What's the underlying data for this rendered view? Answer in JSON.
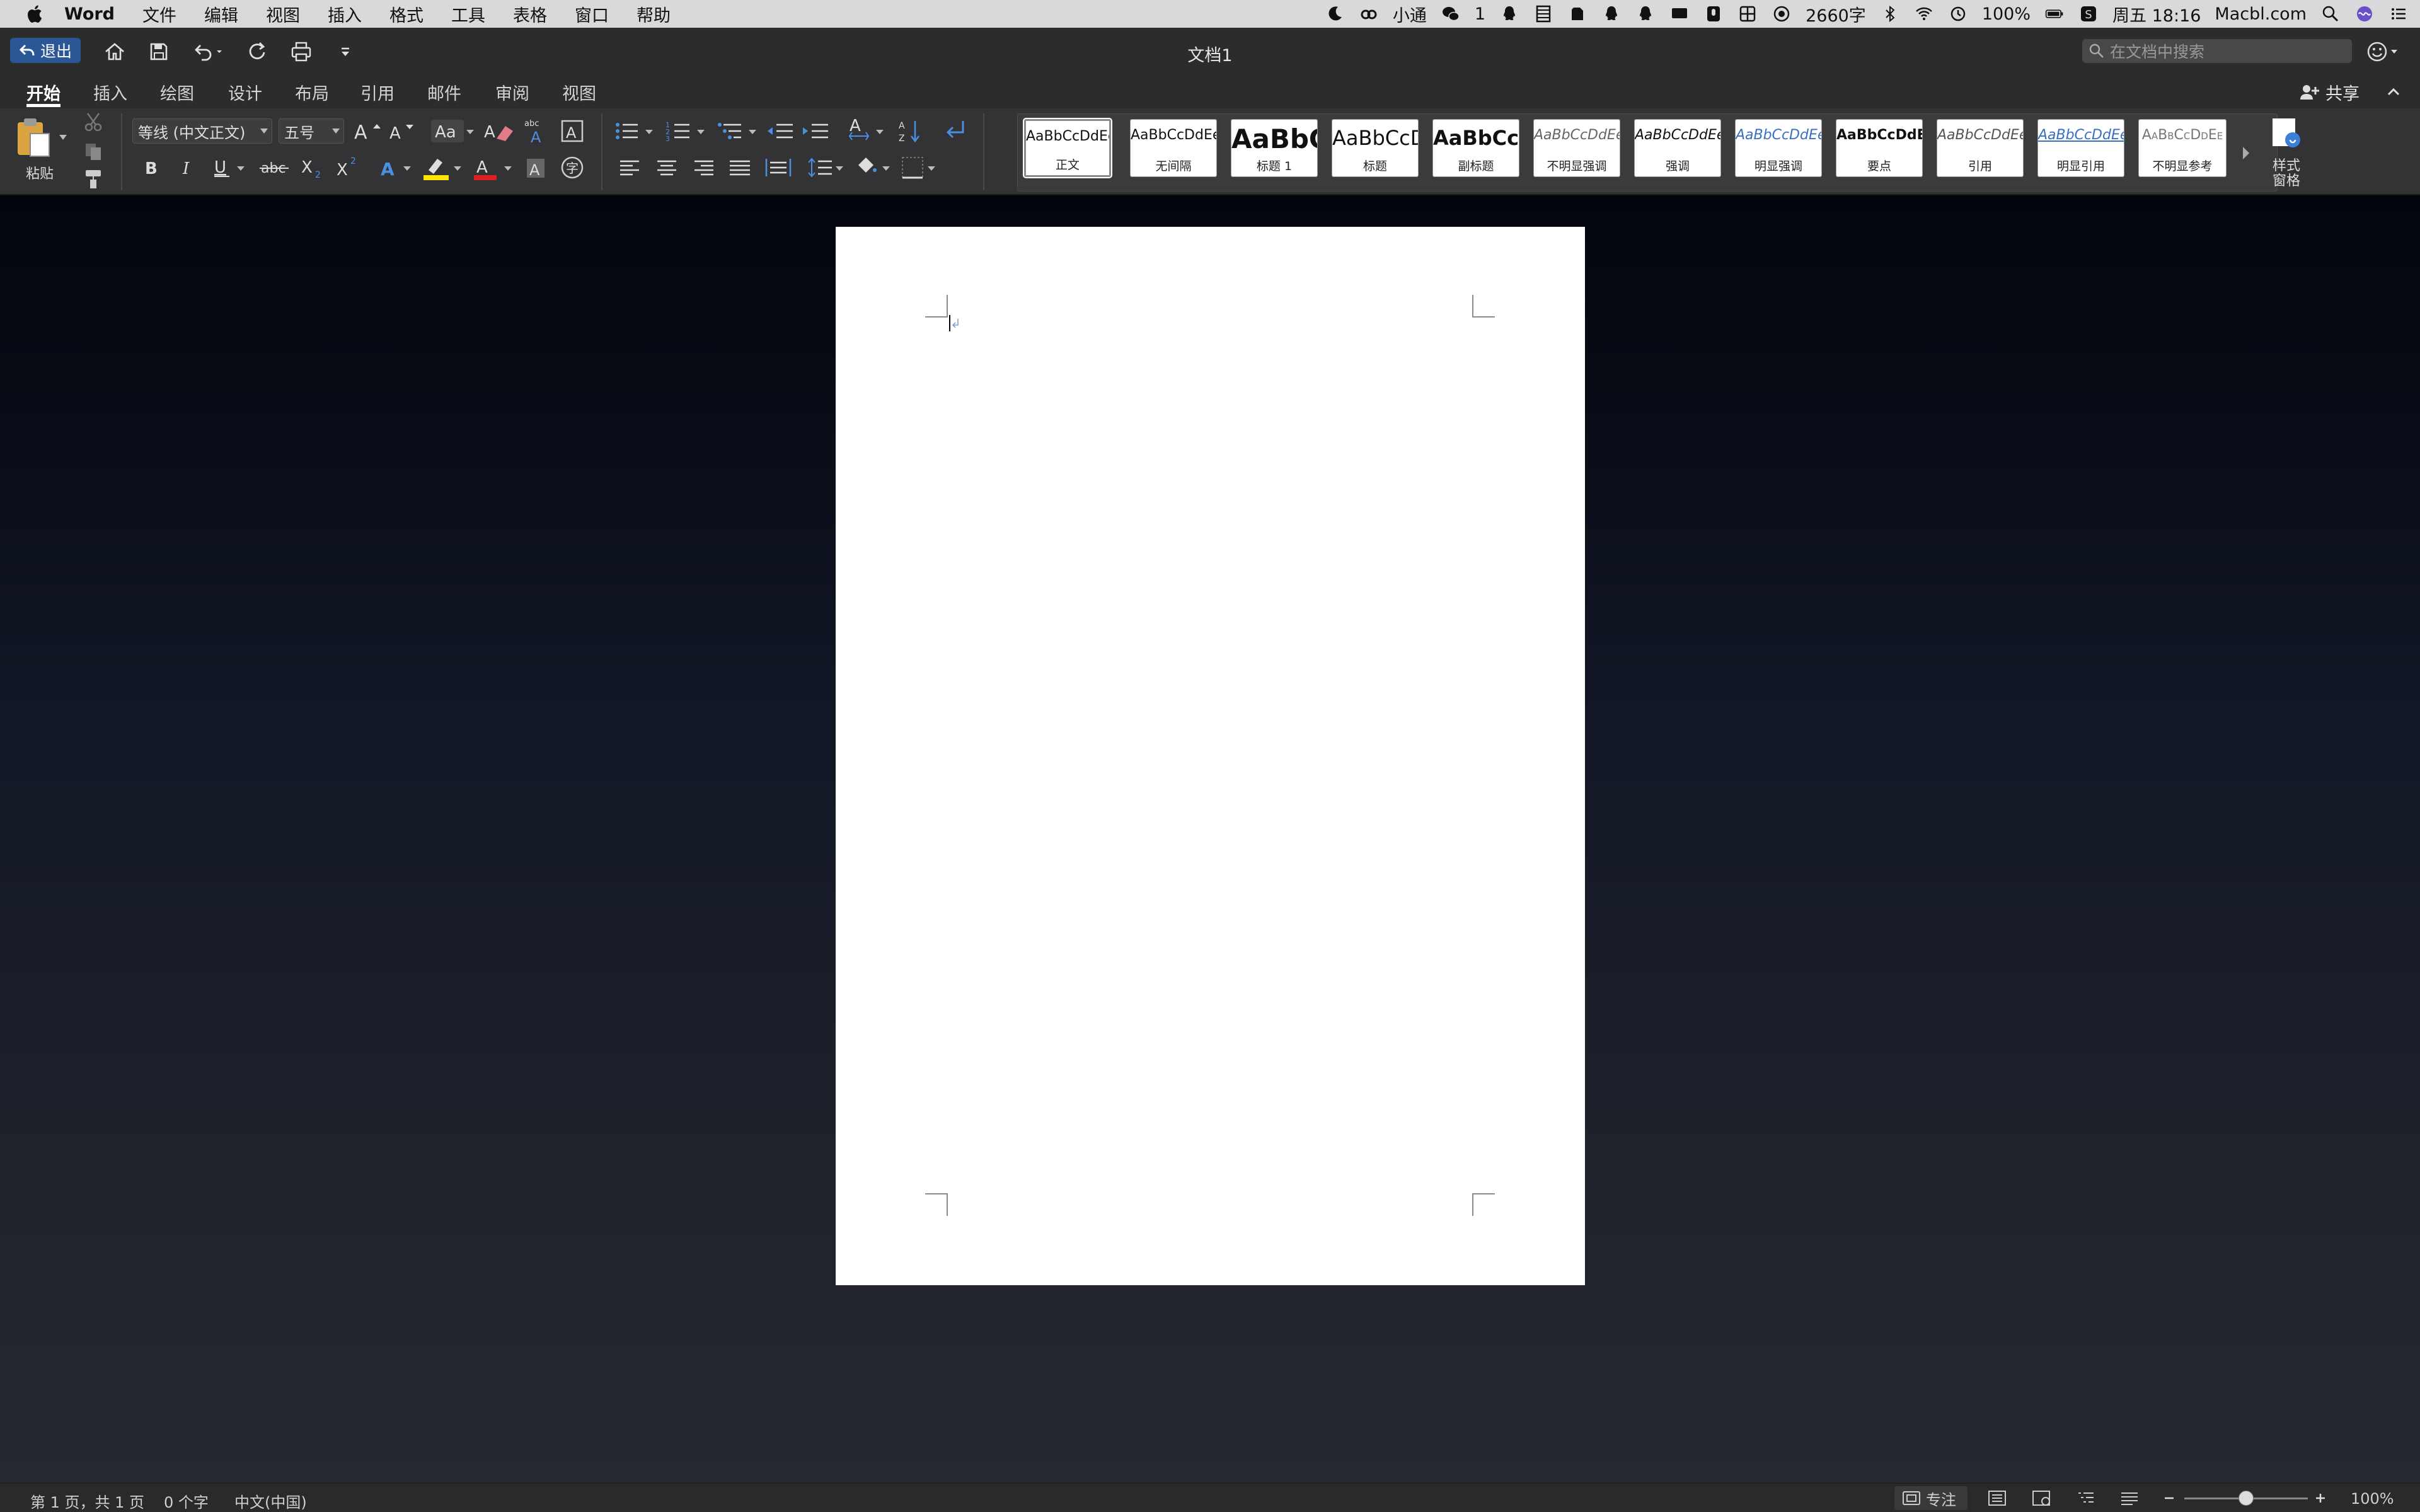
{
  "menubar": {
    "app_name": "Word",
    "items": [
      "文件",
      "编辑",
      "视图",
      "插入",
      "格式",
      "工具",
      "表格",
      "窗口",
      "帮助"
    ],
    "status": {
      "xiaotong": "小通",
      "wechat_count": "1",
      "word_count": "2660字",
      "battery": "100%",
      "datetime": "周五 18:16",
      "site": "Macbl.com"
    }
  },
  "titlebar": {
    "exit_label": "退出",
    "doc_title": "文档1",
    "search_placeholder": "在文档中搜索"
  },
  "tabs": [
    "开始",
    "插入",
    "绘图",
    "设计",
    "布局",
    "引用",
    "邮件",
    "审阅",
    "视图"
  ],
  "active_tab": "开始",
  "share_label": "共享",
  "ribbon": {
    "paste_label": "粘贴",
    "font_name": "等线 (中文正文)",
    "font_size": "五号",
    "styles_pane_label": "样式\n窗格",
    "styles": [
      {
        "sample": "AaBbCcDdEe",
        "name": "正文"
      },
      {
        "sample": "AaBbCcDdEe",
        "name": "无间隔"
      },
      {
        "sample": "AaBbC",
        "name": "标题 1"
      },
      {
        "sample": "AaBbCcD",
        "name": "标题"
      },
      {
        "sample": "AaBbCcD",
        "name": "副标题"
      },
      {
        "sample": "AaBbCcDdEe",
        "name": "不明显强调"
      },
      {
        "sample": "AaBbCcDdEe",
        "name": "强调"
      },
      {
        "sample": "AaBbCcDdEe",
        "name": "明显强调"
      },
      {
        "sample": "AaBbCcDdEe",
        "name": "要点"
      },
      {
        "sample": "AaBbCcDdEe",
        "name": "引用"
      },
      {
        "sample": "AaBbCcDdEe",
        "name": "明显引用"
      },
      {
        "sample": "AaBbCcDdEe",
        "name": "不明显参考"
      }
    ]
  },
  "statusbar": {
    "page_info": "第 1 页，共 1 页",
    "word_count": "0 个字",
    "language": "中文(中国)",
    "focus_label": "专注",
    "zoom": "100%"
  },
  "colors": {
    "accent": "#2b5796",
    "highlight": "#ffe600",
    "font_color": "#e02020"
  }
}
